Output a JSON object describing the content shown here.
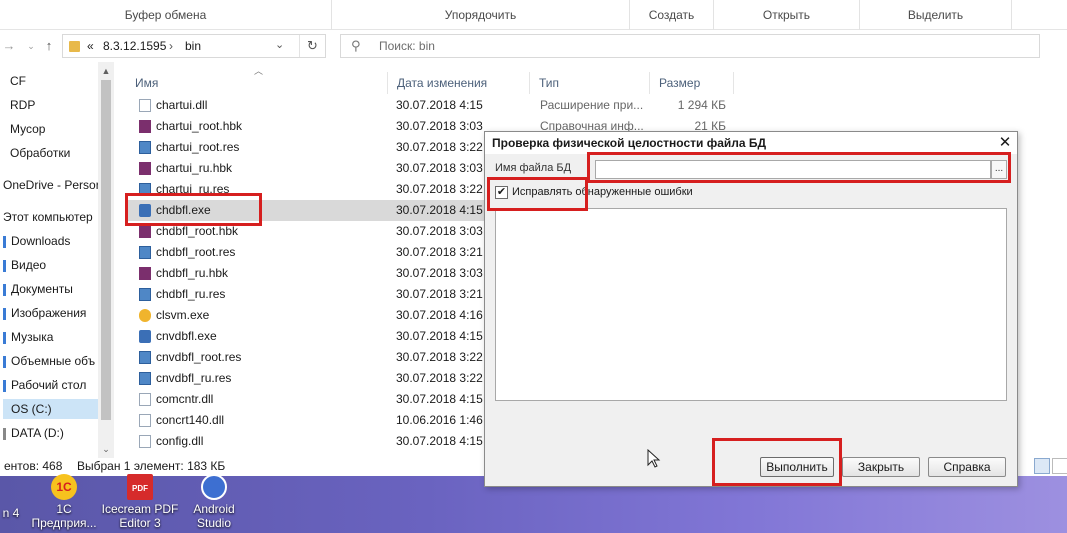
{
  "ribbon": {
    "groups": [
      "Буфер обмена",
      "Упорядочить",
      "Создать",
      "Открыть",
      "Выделить"
    ]
  },
  "address": {
    "overflow": "«",
    "crumbs": [
      "8.3.12.1595",
      "bin"
    ],
    "separator": "›",
    "search_placeholder": "Поиск: bin"
  },
  "nav": {
    "items": [
      {
        "label": "CF",
        "pinned": false
      },
      {
        "label": "RDP",
        "pinned": false
      },
      {
        "label": "Мусор",
        "pinned": false
      },
      {
        "label": "Обработки",
        "pinned": false
      },
      {
        "label": "OneDrive - Persor",
        "pinned": false
      },
      {
        "label": "Этот компьютер",
        "pinned": false
      },
      {
        "label": "Downloads",
        "pinned": true
      },
      {
        "label": "Видео",
        "pinned": true
      },
      {
        "label": "Документы",
        "pinned": true
      },
      {
        "label": "Изображения",
        "pinned": true
      },
      {
        "label": "Музыка",
        "pinned": true
      },
      {
        "label": "Объемные объ",
        "pinned": true
      },
      {
        "label": "Рабочий стол",
        "pinned": true
      },
      {
        "label": "OS (C:)",
        "pinned": false,
        "selected": true
      },
      {
        "label": "DATA (D:)",
        "pinned": false
      }
    ]
  },
  "columns": {
    "name": "Имя",
    "date": "Дата изменения",
    "type": "Тип",
    "size": "Размер"
  },
  "files": [
    {
      "name": "chartui.dll",
      "date": "30.07.2018 4:15",
      "type": "Расширение при...",
      "size": "1 294 КБ",
      "icon": "doc"
    },
    {
      "name": "chartui_root.hbk",
      "date": "30.07.2018 3:03",
      "type": "Справочная инф...",
      "size": "21 КБ",
      "icon": "hbk"
    },
    {
      "name": "chartui_root.res",
      "date": "30.07.2018 3:22",
      "type": "",
      "size": "",
      "icon": "res"
    },
    {
      "name": "chartui_ru.hbk",
      "date": "30.07.2018 3:03",
      "type": "",
      "size": "",
      "icon": "hbk"
    },
    {
      "name": "chartui_ru.res",
      "date": "30.07.2018 3:22",
      "type": "",
      "size": "",
      "icon": "res"
    },
    {
      "name": "chdbfl.exe",
      "date": "30.07.2018 4:15",
      "type": "",
      "size": "",
      "icon": "exe",
      "selected": true
    },
    {
      "name": "chdbfl_root.hbk",
      "date": "30.07.2018 3:03",
      "type": "",
      "size": "",
      "icon": "hbk"
    },
    {
      "name": "chdbfl_root.res",
      "date": "30.07.2018 3:21",
      "type": "",
      "size": "",
      "icon": "res"
    },
    {
      "name": "chdbfl_ru.hbk",
      "date": "30.07.2018 3:03",
      "type": "",
      "size": "",
      "icon": "hbk"
    },
    {
      "name": "chdbfl_ru.res",
      "date": "30.07.2018 3:21",
      "type": "",
      "size": "",
      "icon": "res"
    },
    {
      "name": "clsvm.exe",
      "date": "30.07.2018 4:16",
      "type": "",
      "size": "",
      "icon": "ces"
    },
    {
      "name": "cnvdbfl.exe",
      "date": "30.07.2018 4:15",
      "type": "",
      "size": "",
      "icon": "exe"
    },
    {
      "name": "cnvdbfl_root.res",
      "date": "30.07.2018 3:22",
      "type": "",
      "size": "",
      "icon": "res"
    },
    {
      "name": "cnvdbfl_ru.res",
      "date": "30.07.2018 3:22",
      "type": "",
      "size": "",
      "icon": "res"
    },
    {
      "name": "comcntr.dll",
      "date": "30.07.2018 4:15",
      "type": "",
      "size": "",
      "icon": "doc"
    },
    {
      "name": "concrt140.dll",
      "date": "10.06.2016 1:46",
      "type": "",
      "size": "",
      "icon": "doc"
    },
    {
      "name": "config.dll",
      "date": "30.07.2018 4:15",
      "type": "",
      "size": "",
      "icon": "doc"
    }
  ],
  "status": {
    "count": "ентов: 468",
    "selected": "Выбран 1 элемент: 183 КБ"
  },
  "desktop_icons": [
    {
      "label": "n 4",
      "icon": "app-icon"
    },
    {
      "label": "1С Предприя...",
      "icon": "1c-icon"
    },
    {
      "label": "Icecream PDF Editor 3",
      "icon": "pdf-icon"
    },
    {
      "label": "Android Studio",
      "icon": "android-studio-icon"
    }
  ],
  "dialog": {
    "title": "Проверка физической целостности файла БД",
    "close": "✕",
    "file_label": "Имя файла БД",
    "file_value": "",
    "browse": "...",
    "fix_errors_label": "Исправлять обнаруженные ошибки",
    "fix_errors_checked": true,
    "buttons": {
      "run": "Выполнить",
      "close": "Закрыть",
      "help": "Справка"
    }
  },
  "colors": {
    "annotation": "#d61f1f",
    "selection": "#d9d9d9",
    "nav_selection": "#cce4f7"
  }
}
